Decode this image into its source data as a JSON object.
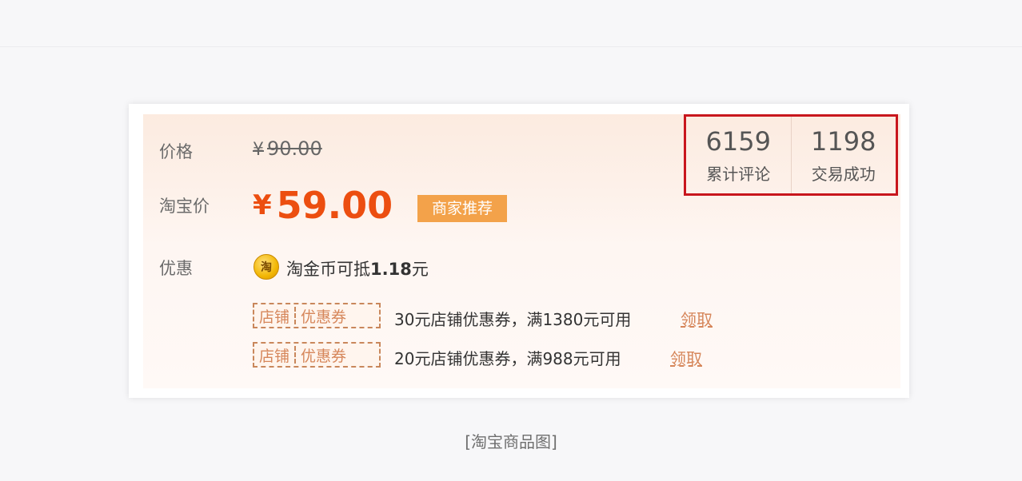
{
  "product": {
    "price_label": "价格",
    "original_currency": "¥",
    "original_price": "90.00",
    "taobao_label": "淘宝价",
    "currency": "¥",
    "taobao_price": "59.00",
    "recommend_badge": "商家推荐",
    "discount_label": "优惠",
    "coin_icon_text": "淘",
    "coin_text_prefix": "淘金币可抵",
    "coin_amount": "1.18",
    "coin_text_suffix": "元"
  },
  "coupons": [
    {
      "tag_left": "店铺",
      "tag_right": "优惠券",
      "text": "30元店铺优惠券，满1380元可用",
      "action": "领取"
    },
    {
      "tag_left": "店铺",
      "tag_right": "优惠券",
      "text": "20元店铺优惠券，满988元可用",
      "action": "领取"
    }
  ],
  "stats": [
    {
      "value": "6159",
      "label": "累计评论"
    },
    {
      "value": "1198",
      "label": "交易成功"
    }
  ],
  "caption": "[淘宝商品图]",
  "colors": {
    "price": "#ec4e10",
    "badge": "#f3a24a",
    "highlight_box": "#c8161d",
    "coupon": "#d6865a"
  }
}
